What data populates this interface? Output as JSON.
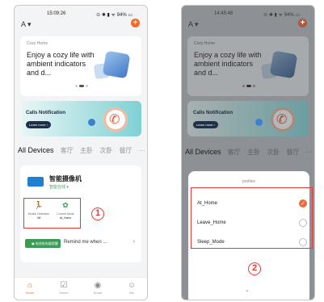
{
  "phone_a": {
    "status": {
      "time": "15:09:26",
      "icons": "⊙ ✱ ▮ ᯤ 94% ▭"
    },
    "home_selector": "A ▾",
    "add_icon": "plus-icon",
    "promo": {
      "tag": "Cozy Home",
      "headline": "Enjoy a cozy life with ambient indicators and d..."
    },
    "calls_banner": {
      "title": "Calls Notification",
      "button": "Learn more ›"
    },
    "tabs": [
      "All Devices",
      "客厅",
      "主卧",
      "次卧",
      "餐厅",
      "···"
    ],
    "device": {
      "name": "智能摄像机",
      "status": "智能在线 ▾",
      "chips": [
        {
          "icon": "motion-detection-icon",
          "label": "Motion Detection",
          "value": "Off"
        },
        {
          "icon": "scene-mode-icon",
          "label": "Current Mode",
          "value": "At_Home"
        }
      ],
      "remind_pill": "▣ 电池低电量提醒",
      "remind_text": "Remind me when ...",
      "remind_chevron": "›"
    },
    "annotation": "1",
    "nav": [
      {
        "icon": "home-icon",
        "label": "Home"
      },
      {
        "icon": "scene-icon",
        "label": "Scene"
      },
      {
        "icon": "smart-icon",
        "label": "Smart"
      },
      {
        "icon": "me-icon",
        "label": "Me"
      }
    ]
  },
  "phone_b": {
    "status": {
      "time": "14:45:48",
      "icons": "⊙ ✱ ▮ ᯤ 94% ▭"
    },
    "home_selector": "A ▾",
    "promo": {
      "tag": "Cozy Home",
      "headline": "Enjoy a cozy life with ambient indicators and d..."
    },
    "calls_banner": {
      "title": "Calls Notification",
      "button": "Learn more ›"
    },
    "tabs": [
      "All Devices",
      "客厅",
      "主卧",
      "次卧",
      "餐厅",
      "···"
    ],
    "sheet": {
      "title": "profiles",
      "options": [
        {
          "label": "At_Home",
          "selected": true
        },
        {
          "label": "Leave_Home",
          "selected": false
        },
        {
          "label": "Sleep_Mode",
          "selected": false
        }
      ],
      "chevron": "⌄"
    },
    "annotation": "2"
  },
  "colors": {
    "accent": "#f26a2e",
    "highlight_box": "#e53935",
    "selected_radio": "#ee6a3a",
    "online_green": "#3b9b55"
  }
}
